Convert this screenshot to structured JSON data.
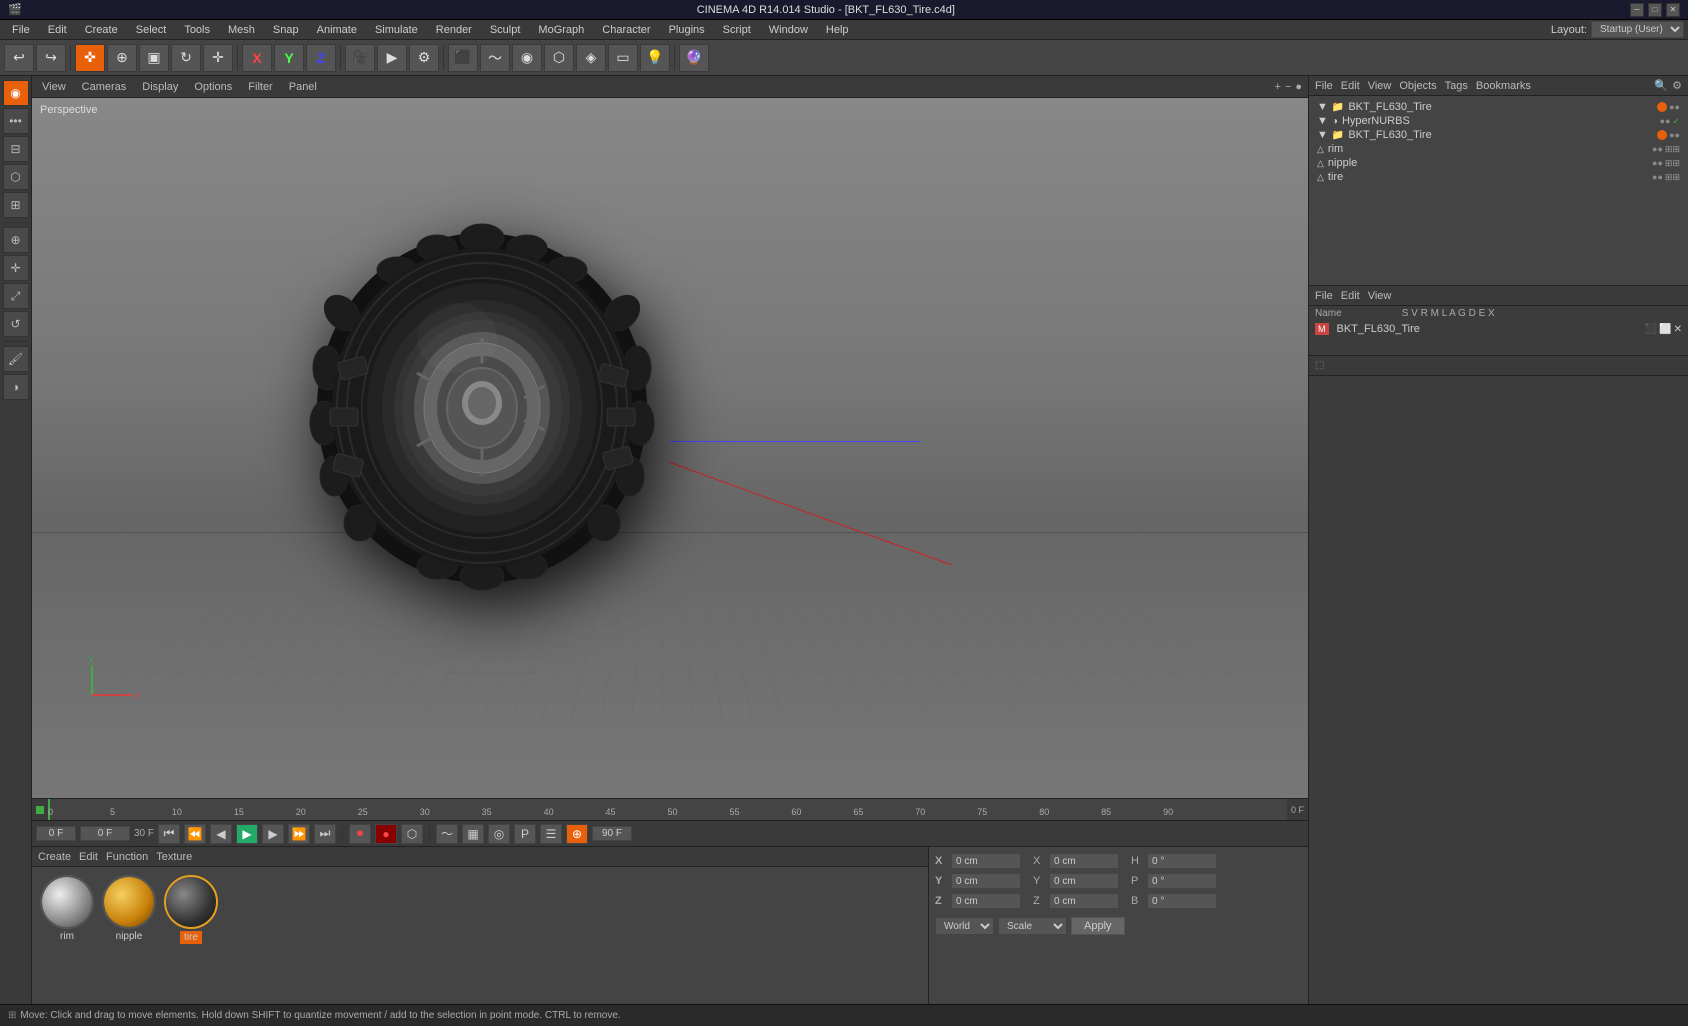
{
  "titlebar": {
    "title": "CINEMA 4D R14.014 Studio - [BKT_FL630_Tire.c4d]",
    "controls": [
      "minimize",
      "maximize",
      "close"
    ]
  },
  "menubar": {
    "items": [
      "File",
      "Edit",
      "Create",
      "Select",
      "Tools",
      "Mesh",
      "Snap",
      "Animate",
      "Simulate",
      "Render",
      "Sculpt",
      "MoGraph",
      "Character",
      "Plugins",
      "Script",
      "Window",
      "Help"
    ],
    "layout_label": "Layout:",
    "layout_value": "Startup (User)"
  },
  "viewport": {
    "menus": [
      "View",
      "Cameras",
      "Display",
      "Options",
      "Filter",
      "Panel"
    ],
    "perspective_label": "Perspective"
  },
  "object_manager": {
    "menus": [
      "File",
      "Edit",
      "View",
      "Objects",
      "Tags",
      "Bookmarks"
    ],
    "objects": [
      {
        "name": "BKT_FL630_Tire",
        "level": 0,
        "color": "orange"
      },
      {
        "name": "HyperNURBS",
        "level": 1,
        "color": "green"
      },
      {
        "name": "BKT_FL630_Tire",
        "level": 2,
        "color": "orange"
      },
      {
        "name": "rim",
        "level": 3
      },
      {
        "name": "nipple",
        "level": 3
      },
      {
        "name": "tire",
        "level": 3
      }
    ]
  },
  "material_manager": {
    "menus": [
      "File",
      "Edit",
      "View"
    ],
    "columns": [
      "Name",
      "S",
      "V",
      "R",
      "M",
      "L",
      "A",
      "G",
      "D",
      "E",
      "X"
    ],
    "items": [
      {
        "name": "BKT_FL630_Tire"
      }
    ]
  },
  "materials": {
    "menus": [
      "Create",
      "Edit",
      "Function",
      "Texture"
    ],
    "swatches": [
      {
        "name": "rim",
        "type": "grey",
        "selected": false
      },
      {
        "name": "nipple",
        "type": "gold",
        "selected": false
      },
      {
        "name": "tire",
        "type": "dark",
        "selected": true
      }
    ]
  },
  "coordinates": {
    "x_pos": "0 cm",
    "y_pos": "0 cm",
    "z_pos": "0 cm",
    "x_size": "0 cm",
    "y_size": "0 cm",
    "z_size": "0 cm",
    "x_rot": "0 °",
    "y_rot": "0 °",
    "z_rot": "0 °",
    "coord_system": "World",
    "transform_type": "Scale",
    "apply_label": "Apply"
  },
  "timeline": {
    "frame_start": "0 F",
    "frame_end": "90 F",
    "fps": "30 F",
    "current_frame": "0 F",
    "ticks": [
      0,
      5,
      10,
      15,
      20,
      25,
      30,
      35,
      40,
      45,
      50,
      55,
      60,
      65,
      70,
      75,
      80,
      85,
      90
    ]
  },
  "statusbar": {
    "message": "Move: Click and drag to move elements. Hold down SHIFT to quantize movement / add to the selection in point mode. CTRL to remove."
  }
}
